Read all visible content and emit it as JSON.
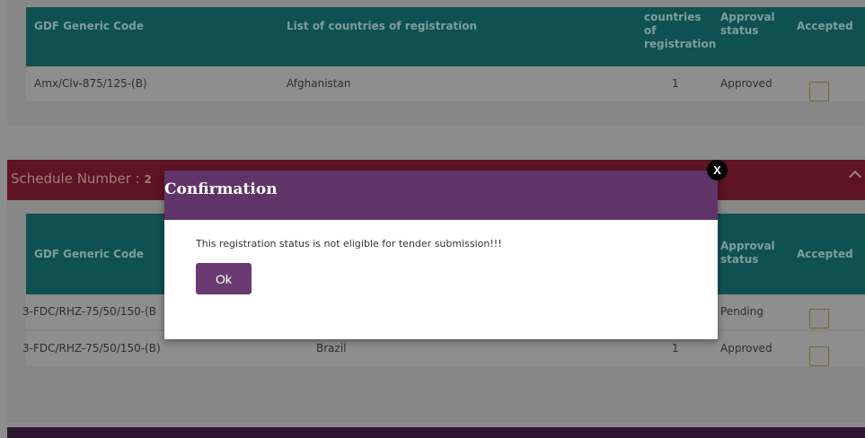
{
  "table1": {
    "headers": {
      "code": "GDF Generic Code",
      "countries": "List of countries of registration",
      "count": "countries of registration",
      "status": "Approval status",
      "accepted": "Accepted"
    },
    "rows": [
      {
        "code": "Amx/Clv-875/125-(B)",
        "country": "Afghanistan",
        "count": "1",
        "status": "Approved"
      }
    ]
  },
  "schedule": {
    "label": "Schedule Number : ",
    "number": "2"
  },
  "table2": {
    "headers": {
      "code": "GDF Generic Code",
      "status": "Approval status",
      "accepted": "Accepted"
    },
    "rows": [
      {
        "code": "3-FDC/RHZ-75/50/150-(B",
        "status": "Pending"
      },
      {
        "code": "3-FDC/RHZ-75/50/150-(B)",
        "country": "Brazil",
        "count": "1",
        "status": "Approved"
      }
    ]
  },
  "modal": {
    "title": "Confirmation",
    "message": "This registration status is not eligible for tender submission!!!",
    "ok_label": "Ok",
    "close_label": "X"
  },
  "colors": {
    "modal_header": "#613469",
    "table_header": "#0f5150",
    "schedule_bar": "#5e1422"
  }
}
